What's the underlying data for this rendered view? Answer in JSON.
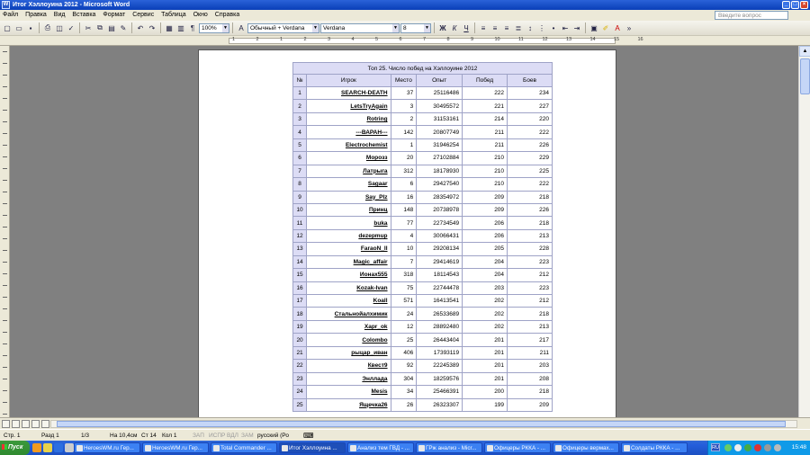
{
  "window": {
    "title": "Итог Хэллоуина 2012 - Microsoft Word"
  },
  "menu": {
    "items": [
      "Файл",
      "Правка",
      "Вид",
      "Вставка",
      "Формат",
      "Сервис",
      "Таблица",
      "Окно",
      "Справка"
    ],
    "help_placeholder": "Введите вопрос"
  },
  "toolbar": {
    "zoom": "100%",
    "style": "Обычный + Verdana",
    "font": "Verdana",
    "size": "8"
  },
  "ruler": {
    "numbers": [
      "1",
      "2",
      "1",
      "2",
      "3",
      "4",
      "5",
      "6",
      "7",
      "8",
      "9",
      "10",
      "11",
      "12",
      "13",
      "14",
      "15",
      "16"
    ]
  },
  "table": {
    "caption": "Топ 25. Число побед на Хэллоуине 2012",
    "headers": [
      "№",
      "Игрок",
      "Место",
      "Опыт",
      "Побед",
      "Боев"
    ],
    "rows": [
      [
        "1",
        "SEARCH-DEATH",
        "37",
        "25116486",
        "222",
        "234"
      ],
      [
        "2",
        "LetsTryAgain",
        "3",
        "30495572",
        "221",
        "227"
      ],
      [
        "3",
        "Rotring",
        "2",
        "31153161",
        "214",
        "220"
      ],
      [
        "4",
        "---ВАРАН---",
        "142",
        "20807749",
        "211",
        "222"
      ],
      [
        "5",
        "Electrochemist",
        "1",
        "31946254",
        "211",
        "226"
      ],
      [
        "6",
        "Морозз",
        "20",
        "27102884",
        "210",
        "229"
      ],
      [
        "7",
        "Латрыга",
        "312",
        "18178930",
        "210",
        "225"
      ],
      [
        "8",
        "Sagaar",
        "6",
        "29427540",
        "210",
        "222"
      ],
      [
        "9",
        "Say_Plz",
        "16",
        "28354972",
        "209",
        "218"
      ],
      [
        "10",
        "Принц",
        "148",
        "20738978",
        "209",
        "226"
      ],
      [
        "11",
        "buka",
        "77",
        "22734549",
        "206",
        "218"
      ],
      [
        "12",
        "dezepmup",
        "4",
        "30066431",
        "206",
        "213"
      ],
      [
        "13",
        "FaraoN_II",
        "10",
        "29208134",
        "205",
        "228"
      ],
      [
        "14",
        "Magic_affair",
        "7",
        "29414619",
        "204",
        "223"
      ],
      [
        "15",
        "Ионах555",
        "318",
        "18114543",
        "204",
        "212"
      ],
      [
        "16",
        "Kozak-Ivan",
        "75",
        "22744478",
        "203",
        "223"
      ],
      [
        "17",
        "Koall",
        "571",
        "16413541",
        "202",
        "212"
      ],
      [
        "18",
        "Стальнойалхимик",
        "24",
        "26533689",
        "202",
        "218"
      ],
      [
        "19",
        "Xapr_ok",
        "12",
        "28892480",
        "202",
        "213"
      ],
      [
        "20",
        "Colombo",
        "25",
        "26443404",
        "201",
        "217"
      ],
      [
        "21",
        "рыцар_иван",
        "406",
        "17393119",
        "201",
        "211"
      ],
      [
        "22",
        "Квест9",
        "92",
        "22245389",
        "201",
        "203"
      ],
      [
        "23",
        "Энллада",
        "304",
        "18259576",
        "201",
        "208"
      ],
      [
        "24",
        "Mesis",
        "34",
        "25466391",
        "200",
        "218"
      ],
      [
        "25",
        "Ящечка26",
        "26",
        "26323307",
        "199",
        "209"
      ]
    ]
  },
  "status": {
    "page": "Стр. 1",
    "section": "Разд 1",
    "pages": "1/3",
    "at": "На 10,4см",
    "line": "Ст 14",
    "col": "Кол 1",
    "rec": "ЗАП",
    "trk": "ИСПР",
    "ext": "ВДЛ",
    "ovr": "ЗАМ",
    "lang": "русский (Ро"
  },
  "taskbar": {
    "start": "Пуск",
    "tasks": [
      "HeroesWM.ru Гер...",
      "HeroesWM.ru Гер...",
      "Total Commander ...",
      "Итог Хэллоуина ...",
      "Анализ тем ГВД - ...",
      "ГРж анализ - Micr...",
      "Офицеры РККА - ...",
      "Офицеры вермах...",
      "Солдаты РККА - ..."
    ],
    "lang": "RU",
    "clock": "15:48"
  },
  "colors": {
    "table_header_bg": "#dcdcf5",
    "title_bar": "#0a3fb8",
    "taskbar": "#245edb",
    "start": "#2f8a2f"
  }
}
